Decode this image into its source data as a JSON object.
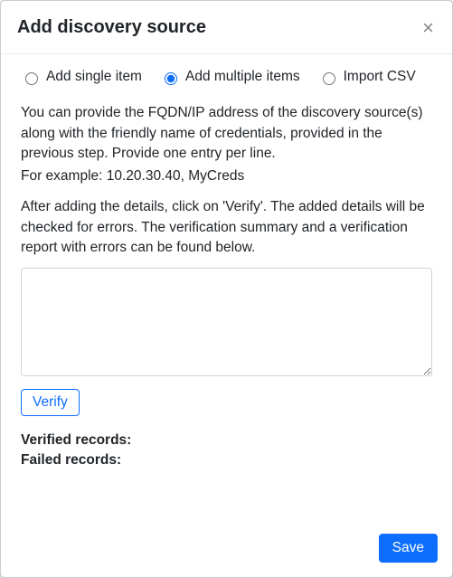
{
  "header": {
    "title": "Add discovery source",
    "close_label": "×"
  },
  "mode": {
    "options": [
      {
        "value": "single",
        "label": "Add single item",
        "checked": false
      },
      {
        "value": "multiple",
        "label": "Add multiple items",
        "checked": true
      },
      {
        "value": "csv",
        "label": "Import CSV",
        "checked": false
      }
    ]
  },
  "instructions": {
    "line1": "You can provide the FQDN/IP address of the discovery source(s) along with the friendly name of credentials, provided in the previous step. Provide one entry per line.",
    "example": "For example: 10.20.30.40, MyCreds",
    "line2": "After adding the details, click on 'Verify'. The added details will be checked for errors. The verification summary and a verification report with errors can be found below."
  },
  "entries": {
    "value": "",
    "placeholder": ""
  },
  "buttons": {
    "verify": "Verify",
    "save": "Save"
  },
  "results": {
    "verified_label": "Verified records:",
    "failed_label": "Failed records:"
  }
}
